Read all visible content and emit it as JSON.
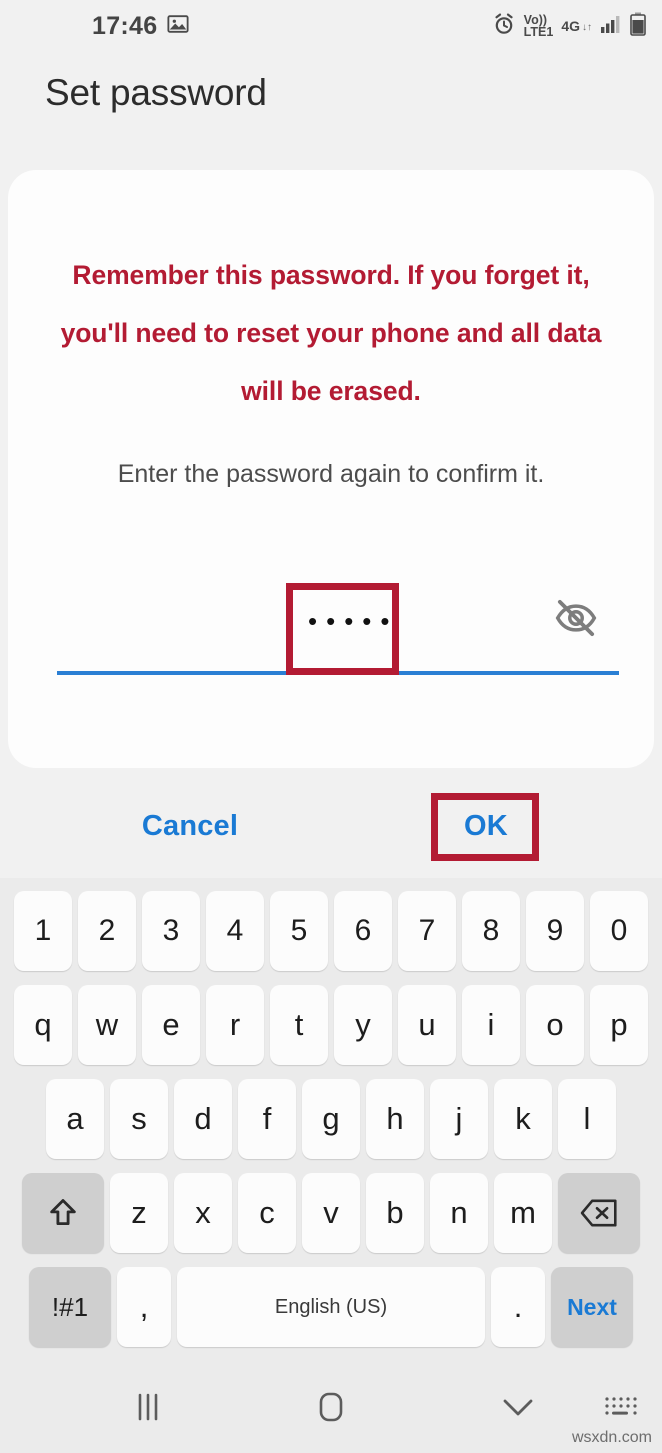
{
  "status_bar": {
    "time": "17:46",
    "left_icons": [
      "image-icon"
    ],
    "right_icons": [
      "alarm-icon",
      "volte-icon",
      "4g-icon",
      "data-arrows-icon",
      "signal-bars-icon",
      "battery-icon"
    ],
    "volte_top": "Vo))",
    "volte_bottom": "LTE1",
    "network": "4G"
  },
  "page_title": "Set password",
  "dialog": {
    "warning": "Remember this password. If you forget it, you'll need to reset your phone and all data will be erased.",
    "instruction": "Enter the password again to confirm it.",
    "password_value": "•••••",
    "password_char_count": 5,
    "visibility_icon": "eye-off-icon"
  },
  "actions": {
    "cancel_label": "Cancel",
    "ok_label": "OK"
  },
  "colors": {
    "warning_red": "#b31b33",
    "action_blue": "#1a7ad4",
    "underline_blue": "#2a7fd4",
    "annotation_red": "#b31b33",
    "keyboard_bg": "#ebebeb",
    "card_bg": "#fdfdfd",
    "screen_bg": "#f1f1f1"
  },
  "annotations": [
    {
      "name": "password-field-highlight",
      "target": "password input"
    },
    {
      "name": "ok-button-highlight",
      "target": "OK button"
    }
  ],
  "keyboard": {
    "row_numbers": [
      "1",
      "2",
      "3",
      "4",
      "5",
      "6",
      "7",
      "8",
      "9",
      "0"
    ],
    "row_qwerty": [
      "q",
      "w",
      "e",
      "r",
      "t",
      "y",
      "u",
      "i",
      "o",
      "p"
    ],
    "row_asdf": [
      "a",
      "s",
      "d",
      "f",
      "g",
      "h",
      "j",
      "k",
      "l"
    ],
    "row_zxcv": [
      "z",
      "x",
      "c",
      "v",
      "b",
      "n",
      "m"
    ],
    "shift_key": "shift-icon",
    "backspace_key": "backspace-icon",
    "symbols_key": "!#1",
    "comma_key": ",",
    "space_key": "English (US)",
    "period_key": ".",
    "next_key": "Next"
  },
  "nav_bar": {
    "recents": "recents-icon",
    "home": "home-icon",
    "hide_keyboard": "chevron-down-icon",
    "keyboard_switch": "keyboard-switch-icon"
  },
  "watermark": "wsxdn.com"
}
